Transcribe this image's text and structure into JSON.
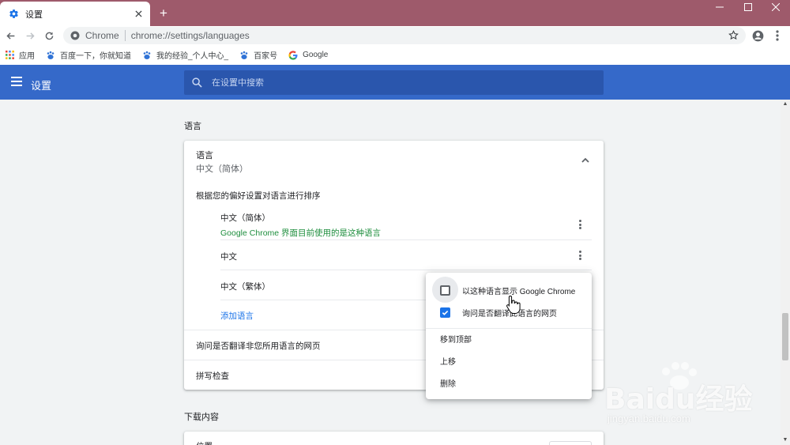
{
  "browser": {
    "tab_title": "设置",
    "new_tab_label": "+",
    "window_controls": {
      "minimize": "—",
      "maximize": "☐",
      "close": "✕"
    },
    "omnibox": {
      "site_name": "Chrome",
      "url": "chrome://settings/languages"
    },
    "accent_color": "#9e5a6b"
  },
  "bookmarks": [
    {
      "label": "应用",
      "icon": "apps-grid-icon"
    },
    {
      "label": "百度一下，你就知道",
      "icon": "baidu-paw-icon"
    },
    {
      "label": "我的经验_个人中心_",
      "icon": "baidu-paw-icon"
    },
    {
      "label": "百家号",
      "icon": "baidu-paw-icon"
    },
    {
      "label": "Google",
      "icon": "google-g-icon"
    }
  ],
  "settings": {
    "header_title": "设置",
    "search_placeholder": "在设置中搜索",
    "header_color": "#3569c9"
  },
  "languages_section": {
    "title": "语言",
    "card": {
      "heading": "语言",
      "current": "中文（简体）",
      "order_label": "根据您的偏好设置对语言进行排序",
      "languages": [
        {
          "name": "中文（简体）",
          "note": "Google Chrome 界面目前使用的是这种语言"
        },
        {
          "name": "中文",
          "note": ""
        },
        {
          "name": "中文（繁体）",
          "note": ""
        }
      ],
      "add_language": "添加语言",
      "offer_translate": "询问是否翻译非您所用语言的网页",
      "spell_check": "拼写检查"
    }
  },
  "downloads_section": {
    "title": "下载内容",
    "location_label": "位置"
  },
  "context_menu": {
    "display_in_chrome": "以这种语言显示 Google Chrome",
    "display_checked": false,
    "offer_translate": "询问是否翻译此语言的网页",
    "offer_translate_checked": true,
    "move_to_top": "移到顶部",
    "move_up": "上移",
    "remove": "删除"
  },
  "watermark": {
    "main": "Baidu经验",
    "sub": "jingyan.baidu.com"
  }
}
